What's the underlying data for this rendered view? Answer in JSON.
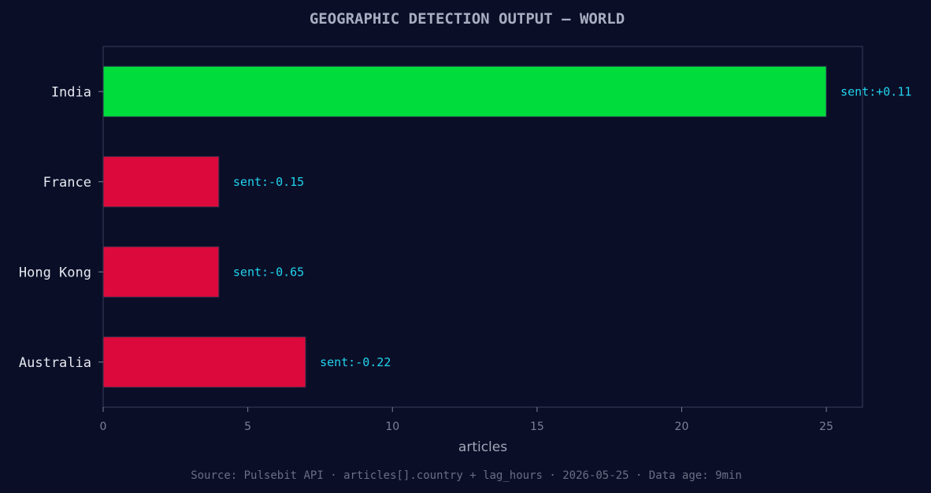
{
  "chart_data": {
    "type": "bar",
    "orientation": "horizontal",
    "title": "GEOGRAPHIC DETECTION OUTPUT — WORLD",
    "xlabel": "articles",
    "ylabel": "",
    "categories": [
      "India",
      "France",
      "Hong Kong",
      "Australia"
    ],
    "values": [
      25,
      4,
      4,
      7
    ],
    "annotations": [
      "sent:+0.11",
      "sent:-0.15",
      "sent:-0.65",
      "sent:-0.22"
    ],
    "xlim": [
      0,
      26.25
    ],
    "xticks": [
      0,
      5,
      10,
      15,
      20,
      25
    ],
    "grid": false,
    "footer": "Source: Pulsebit API · articles[].country + lag_hours · 2026-05-25 · Data age: 9min",
    "colors": {
      "background": "#0a0e27",
      "positive": "#00dc3c",
      "negative": "#dc0a3c",
      "annotation": "#22d3ee",
      "axis": "#2a2f4a"
    }
  }
}
